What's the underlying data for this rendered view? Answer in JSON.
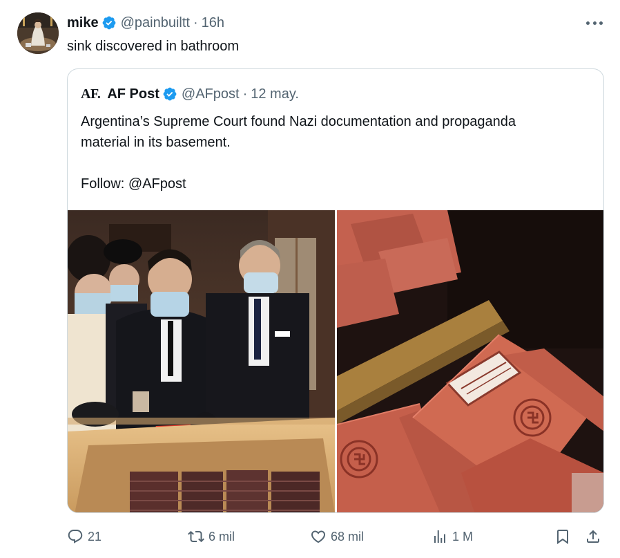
{
  "author": {
    "name": "mike",
    "handle": "@painbuiltt",
    "separator": "·",
    "time": "16h"
  },
  "tweet_text": "sink discovered in bathroom",
  "more_icon": "more-horizontal-icon",
  "quote": {
    "logo": "AF.",
    "name": "AF Post",
    "handle": "@AFpost",
    "separator": "·",
    "date": "12 may.",
    "lines": [
      "Argentina’s Supreme Court found Nazi documentation and propaganda",
      "material in its basement."
    ],
    "follow": "Follow: @AFpost",
    "images": [
      {
        "description": "officials in masks examining box of documents",
        "icon": "photo-icon"
      },
      {
        "description": "red booklets with emblems in a drawer",
        "icon": "photo-icon"
      }
    ]
  },
  "actions": {
    "reply": {
      "count": "21",
      "icon": "reply-icon"
    },
    "repost": {
      "count": "6 mil",
      "icon": "repost-icon"
    },
    "like": {
      "count": "68 mil",
      "icon": "heart-icon"
    },
    "views": {
      "count": "1 M",
      "icon": "views-icon"
    },
    "bookmark": {
      "icon": "bookmark-icon"
    },
    "share": {
      "icon": "share-icon"
    }
  },
  "colors": {
    "text": "#0f1419",
    "secondary": "#536471",
    "border": "#cfd9de",
    "verified": "#1d9bf0"
  }
}
